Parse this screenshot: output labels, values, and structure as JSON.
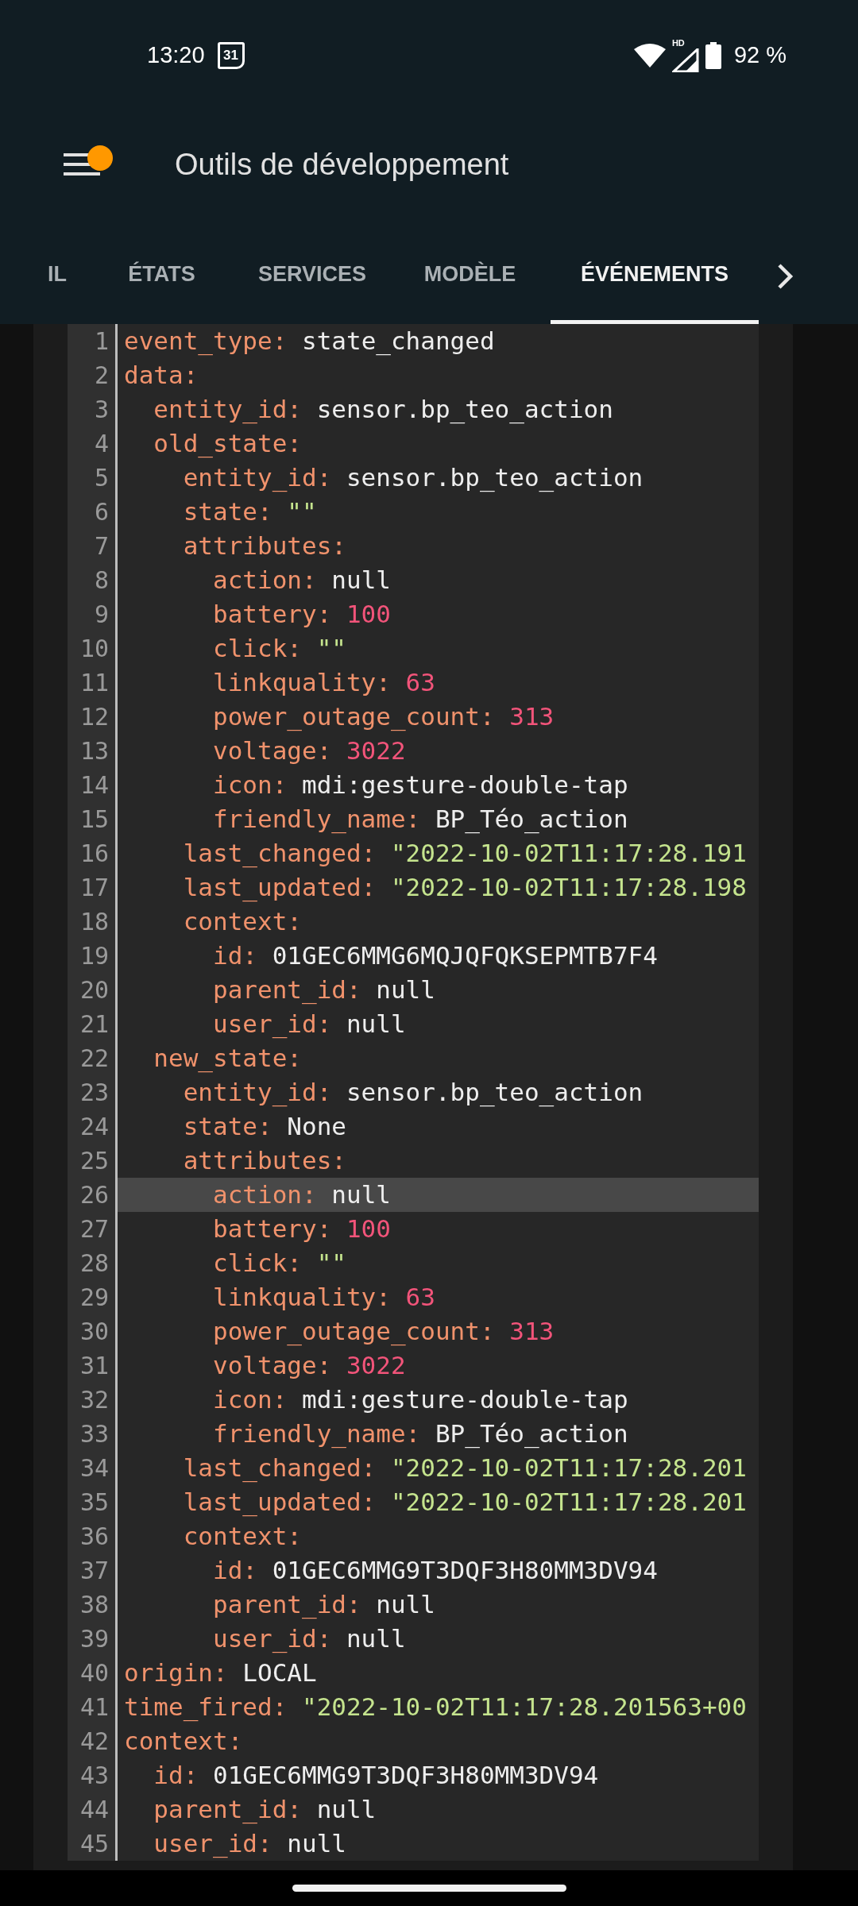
{
  "status_bar": {
    "time": "13:20",
    "calendar_day": "31",
    "network_badge": "HD",
    "battery": "92 %"
  },
  "app_bar": {
    "title": "Outils de développement",
    "notification": true
  },
  "tabs": [
    {
      "label": "IL",
      "selected": false
    },
    {
      "label": "ÉTATS",
      "selected": false
    },
    {
      "label": "SERVICES",
      "selected": false
    },
    {
      "label": "MODÈLE",
      "selected": false
    },
    {
      "label": "ÉVÉNEMENTS",
      "selected": true
    }
  ],
  "editor": {
    "lines": [
      {
        "number": "1",
        "current": false,
        "tokens": [
          {
            "kind": "key",
            "text": "event_type:"
          },
          {
            "kind": "plain",
            "text": " state_changed"
          }
        ]
      },
      {
        "number": "2",
        "current": false,
        "tokens": [
          {
            "kind": "key",
            "text": "data:"
          }
        ]
      },
      {
        "number": "3",
        "current": false,
        "tokens": [
          {
            "kind": "key",
            "text": "  entity_id:"
          },
          {
            "kind": "plain",
            "text": " sensor.bp_teo_action"
          }
        ]
      },
      {
        "number": "4",
        "current": false,
        "tokens": [
          {
            "kind": "key",
            "text": "  old_state:"
          }
        ]
      },
      {
        "number": "5",
        "current": false,
        "tokens": [
          {
            "kind": "key",
            "text": "    entity_id:"
          },
          {
            "kind": "plain",
            "text": " sensor.bp_teo_action"
          }
        ]
      },
      {
        "number": "6",
        "current": false,
        "tokens": [
          {
            "kind": "key",
            "text": "    state:"
          },
          {
            "kind": "string",
            "text": " \"\""
          }
        ]
      },
      {
        "number": "7",
        "current": false,
        "tokens": [
          {
            "kind": "key",
            "text": "    attributes:"
          }
        ]
      },
      {
        "number": "8",
        "current": false,
        "tokens": [
          {
            "kind": "key",
            "text": "      action:"
          },
          {
            "kind": "plain",
            "text": " null"
          }
        ]
      },
      {
        "number": "9",
        "current": false,
        "tokens": [
          {
            "kind": "key",
            "text": "      battery:"
          },
          {
            "kind": "number",
            "text": " 100"
          }
        ]
      },
      {
        "number": "10",
        "current": false,
        "tokens": [
          {
            "kind": "key",
            "text": "      click:"
          },
          {
            "kind": "string",
            "text": " \"\""
          }
        ]
      },
      {
        "number": "11",
        "current": false,
        "tokens": [
          {
            "kind": "key",
            "text": "      linkquality:"
          },
          {
            "kind": "number",
            "text": " 63"
          }
        ]
      },
      {
        "number": "12",
        "current": false,
        "tokens": [
          {
            "kind": "key",
            "text": "      power_outage_count:"
          },
          {
            "kind": "number",
            "text": " 313"
          }
        ]
      },
      {
        "number": "13",
        "current": false,
        "tokens": [
          {
            "kind": "key",
            "text": "      voltage:"
          },
          {
            "kind": "number",
            "text": " 3022"
          }
        ]
      },
      {
        "number": "14",
        "current": false,
        "tokens": [
          {
            "kind": "key",
            "text": "      icon:"
          },
          {
            "kind": "plain",
            "text": " mdi:gesture-double-tap"
          }
        ]
      },
      {
        "number": "15",
        "current": false,
        "tokens": [
          {
            "kind": "key",
            "text": "      friendly_name:"
          },
          {
            "kind": "plain",
            "text": " BP_Téo_action"
          }
        ]
      },
      {
        "number": "16",
        "current": false,
        "tokens": [
          {
            "kind": "key",
            "text": "    last_changed:"
          },
          {
            "kind": "string",
            "text": " \"2022-10-02T11:17:28.191"
          }
        ]
      },
      {
        "number": "17",
        "current": false,
        "tokens": [
          {
            "kind": "key",
            "text": "    last_updated:"
          },
          {
            "kind": "string",
            "text": " \"2022-10-02T11:17:28.198"
          }
        ]
      },
      {
        "number": "18",
        "current": false,
        "tokens": [
          {
            "kind": "key",
            "text": "    context:"
          }
        ]
      },
      {
        "number": "19",
        "current": false,
        "tokens": [
          {
            "kind": "key",
            "text": "      id:"
          },
          {
            "kind": "plain",
            "text": " 01GEC6MMG6MQJQFQKSEPMTB7F4"
          }
        ]
      },
      {
        "number": "20",
        "current": false,
        "tokens": [
          {
            "kind": "key",
            "text": "      parent_id:"
          },
          {
            "kind": "plain",
            "text": " null"
          }
        ]
      },
      {
        "number": "21",
        "current": false,
        "tokens": [
          {
            "kind": "key",
            "text": "      user_id:"
          },
          {
            "kind": "plain",
            "text": " null"
          }
        ]
      },
      {
        "number": "22",
        "current": false,
        "tokens": [
          {
            "kind": "key",
            "text": "  new_state:"
          }
        ]
      },
      {
        "number": "23",
        "current": false,
        "tokens": [
          {
            "kind": "key",
            "text": "    entity_id:"
          },
          {
            "kind": "plain",
            "text": " sensor.bp_teo_action"
          }
        ]
      },
      {
        "number": "24",
        "current": false,
        "tokens": [
          {
            "kind": "key",
            "text": "    state:"
          },
          {
            "kind": "plain",
            "text": " None"
          }
        ]
      },
      {
        "number": "25",
        "current": false,
        "tokens": [
          {
            "kind": "key",
            "text": "    attributes:"
          }
        ]
      },
      {
        "number": "26",
        "current": true,
        "tokens": [
          {
            "kind": "key",
            "text": "      action:"
          },
          {
            "kind": "plain",
            "text": " null"
          }
        ]
      },
      {
        "number": "27",
        "current": false,
        "tokens": [
          {
            "kind": "key",
            "text": "      battery:"
          },
          {
            "kind": "number",
            "text": " 100"
          }
        ]
      },
      {
        "number": "28",
        "current": false,
        "tokens": [
          {
            "kind": "key",
            "text": "      click:"
          },
          {
            "kind": "string",
            "text": " \"\""
          }
        ]
      },
      {
        "number": "29",
        "current": false,
        "tokens": [
          {
            "kind": "key",
            "text": "      linkquality:"
          },
          {
            "kind": "number",
            "text": " 63"
          }
        ]
      },
      {
        "number": "30",
        "current": false,
        "tokens": [
          {
            "kind": "key",
            "text": "      power_outage_count:"
          },
          {
            "kind": "number",
            "text": " 313"
          }
        ]
      },
      {
        "number": "31",
        "current": false,
        "tokens": [
          {
            "kind": "key",
            "text": "      voltage:"
          },
          {
            "kind": "number",
            "text": " 3022"
          }
        ]
      },
      {
        "number": "32",
        "current": false,
        "tokens": [
          {
            "kind": "key",
            "text": "      icon:"
          },
          {
            "kind": "plain",
            "text": " mdi:gesture-double-tap"
          }
        ]
      },
      {
        "number": "33",
        "current": false,
        "tokens": [
          {
            "kind": "key",
            "text": "      friendly_name:"
          },
          {
            "kind": "plain",
            "text": " BP_Téo_action"
          }
        ]
      },
      {
        "number": "34",
        "current": false,
        "tokens": [
          {
            "kind": "key",
            "text": "    last_changed:"
          },
          {
            "kind": "string",
            "text": " \"2022-10-02T11:17:28.201"
          }
        ]
      },
      {
        "number": "35",
        "current": false,
        "tokens": [
          {
            "kind": "key",
            "text": "    last_updated:"
          },
          {
            "kind": "string",
            "text": " \"2022-10-02T11:17:28.201"
          }
        ]
      },
      {
        "number": "36",
        "current": false,
        "tokens": [
          {
            "kind": "key",
            "text": "    context:"
          }
        ]
      },
      {
        "number": "37",
        "current": false,
        "tokens": [
          {
            "kind": "key",
            "text": "      id:"
          },
          {
            "kind": "plain",
            "text": " 01GEC6MMG9T3DQF3H80MM3DV94"
          }
        ]
      },
      {
        "number": "38",
        "current": false,
        "tokens": [
          {
            "kind": "key",
            "text": "      parent_id:"
          },
          {
            "kind": "plain",
            "text": " null"
          }
        ]
      },
      {
        "number": "39",
        "current": false,
        "tokens": [
          {
            "kind": "key",
            "text": "      user_id:"
          },
          {
            "kind": "plain",
            "text": " null"
          }
        ]
      },
      {
        "number": "40",
        "current": false,
        "tokens": [
          {
            "kind": "key",
            "text": "origin:"
          },
          {
            "kind": "plain",
            "text": " LOCAL"
          }
        ]
      },
      {
        "number": "41",
        "current": false,
        "tokens": [
          {
            "kind": "key",
            "text": "time_fired:"
          },
          {
            "kind": "string",
            "text": " \"2022-10-02T11:17:28.201563+00"
          }
        ]
      },
      {
        "number": "42",
        "current": false,
        "tokens": [
          {
            "kind": "key",
            "text": "context:"
          }
        ]
      },
      {
        "number": "43",
        "current": false,
        "tokens": [
          {
            "kind": "key",
            "text": "  id:"
          },
          {
            "kind": "plain",
            "text": " 01GEC6MMG9T3DQF3H80MM3DV94"
          }
        ]
      },
      {
        "number": "44",
        "current": false,
        "tokens": [
          {
            "kind": "key",
            "text": "  parent_id:"
          },
          {
            "kind": "plain",
            "text": " null"
          }
        ]
      },
      {
        "number": "45",
        "current": false,
        "tokens": [
          {
            "kind": "key",
            "text": "  user_id:"
          },
          {
            "kind": "plain",
            "text": " null"
          }
        ]
      }
    ]
  }
}
